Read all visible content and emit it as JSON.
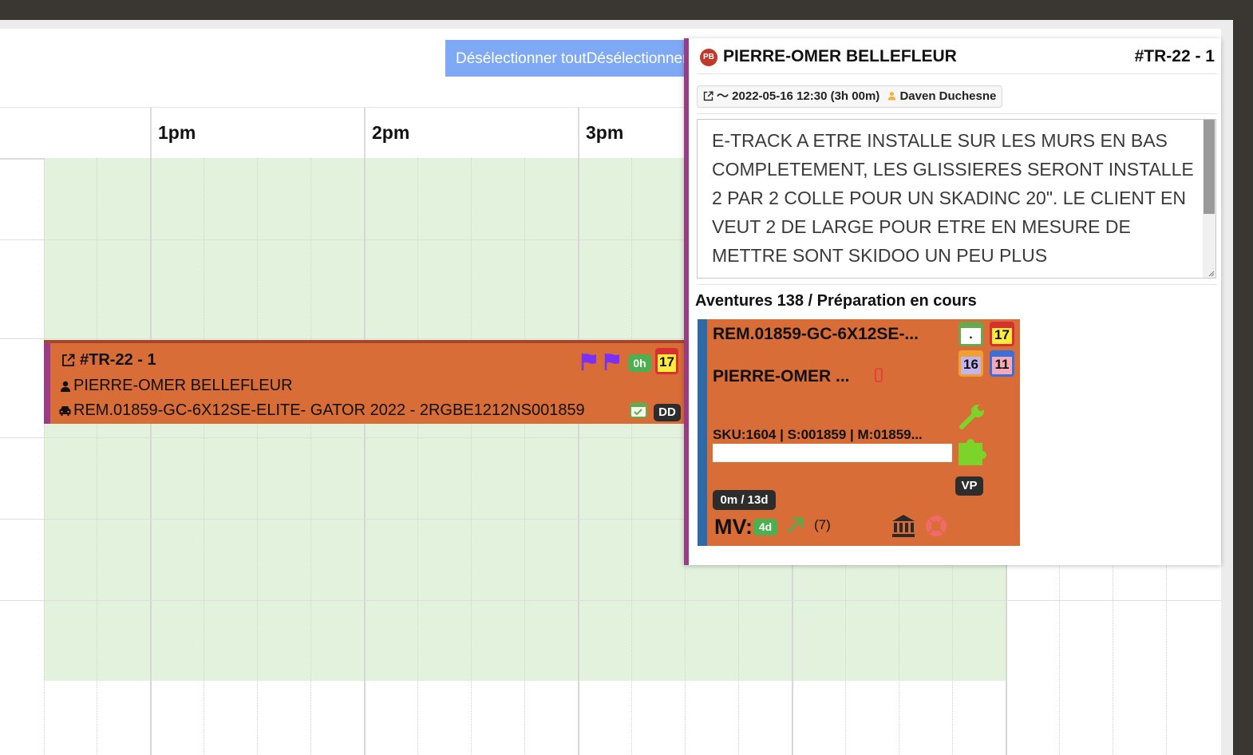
{
  "toolbar": {
    "deselect_label": "Désélectionner toutDésélectionner tout"
  },
  "timeline": {
    "hours": [
      "1pm",
      "2pm",
      "3pm"
    ]
  },
  "event": {
    "ticket": "#TR-22 - 1",
    "customer": "PIERRE-OMER BELLEFLEUR",
    "vehicle": "REM.01859-GC-6X12SE-ELITE- GATOR 2022 - 2RGBE1212NS001859",
    "hours_badge": "0h",
    "day_badge": "17",
    "initials_badge": "DD",
    "accent_color": "#d86d38",
    "stripe_color": "#9b3a87",
    "flag_color": "#7b2ff7"
  },
  "popup": {
    "avatar_initials": "PB",
    "name": "PIERRE-OMER BELLEFLEUR",
    "ticket": "#TR-22 - 1",
    "meta_date": "〜 2022-05-16 12:30 (3h 00m)",
    "meta_user": "Daven Duchesne",
    "notes": "E-TRACK A ETRE INSTALLE SUR LES MURS EN BAS COMPLETEMENT, LES GLISSIERES SERONT INSTALLE 2 PAR 2 COLLE POUR UN SKADINC 20\". LE CLIENT EN VEUT 2 DE LARGE POUR ETRE EN MESURE DE METTRE SONT SKIDOO UN PEU PLUS",
    "location": "Aventures 138 / Préparation en cours",
    "card": {
      "title": "REM.01859-GC-6X12SE-...",
      "customer": "PIERRE-OMER ...",
      "sku": "SKU:1604 | S:001859 | M:01859...",
      "cal_dot": ".",
      "cal_a": "17",
      "cal_b": "16",
      "cal_c": "11",
      "vp_badge": "VP",
      "duration_badge": "0m / 13d",
      "mv_label": "MV:",
      "mv_days": "4d",
      "mv_count": "(7)"
    }
  }
}
